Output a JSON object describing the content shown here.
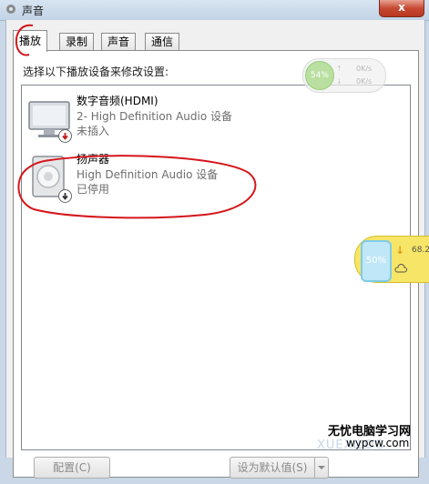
{
  "window": {
    "title": "声音",
    "close_label": "x"
  },
  "tabs": [
    {
      "label": "播放",
      "active": true
    },
    {
      "label": "录制",
      "active": false
    },
    {
      "label": "声音",
      "active": false
    },
    {
      "label": "通信",
      "active": false
    }
  ],
  "panel": {
    "instruction": "选择以下播放设备来修改设置:"
  },
  "devices": [
    {
      "name": "数字音频(HDMI)",
      "description": "2- High Definition Audio 设备",
      "status": "未插入",
      "icon": "monitor-icon",
      "badge": "unplugged-badge"
    },
    {
      "name": "扬声器",
      "description": "High Definition Audio 设备",
      "status": "已停用",
      "icon": "speaker-icon",
      "badge": "disabled-badge"
    }
  ],
  "buttons": {
    "configure": "配置(C)",
    "set_default": "设为默认值(S)"
  },
  "net_widget": {
    "percent": "54%",
    "upload": "0K/s",
    "download": "0K/s"
  },
  "yellow_widget": {
    "percent": "50%",
    "speed": "68.2"
  },
  "watermark": {
    "line1": "无忧电脑学习网",
    "line2": "wypcw.com",
    "faint": "XUEXILOG"
  },
  "colors": {
    "annotation_red": "#d5161b",
    "accent_blue": "#1e67b8"
  }
}
